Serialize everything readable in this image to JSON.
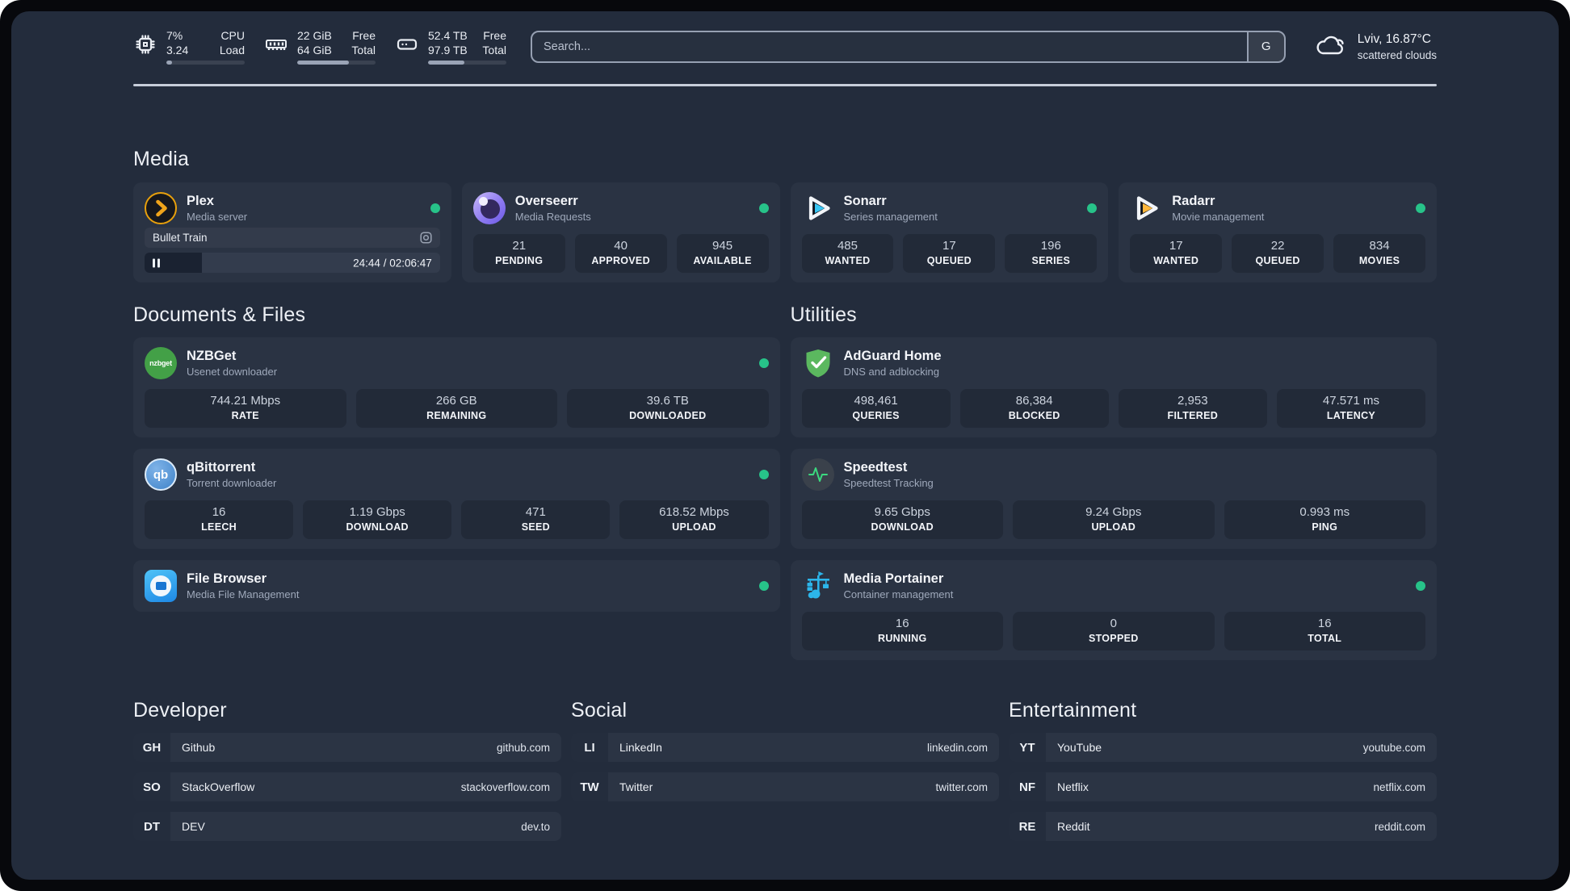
{
  "topbar": {
    "stats": [
      {
        "id": "cpu",
        "value_primary": "7%",
        "value_secondary": "3.24",
        "label_primary": "CPU",
        "label_secondary": "Load",
        "progress_pct": 7
      },
      {
        "id": "memory",
        "value_primary": "22 GiB",
        "value_secondary": "64 GiB",
        "label_primary": "Free",
        "label_secondary": "Total",
        "progress_pct": 66
      },
      {
        "id": "disk",
        "value_primary": "52.4 TB",
        "value_secondary": "97.9 TB",
        "label_primary": "Free",
        "label_secondary": "Total",
        "progress_pct": 46
      }
    ],
    "search": {
      "placeholder": "Search...",
      "engine_button": "G"
    },
    "weather": {
      "location": "Lviv, 16.87°C",
      "condition": "scattered clouds"
    }
  },
  "sections": {
    "media": "Media",
    "documents": "Documents & Files",
    "utilities": "Utilities",
    "developer": "Developer",
    "social": "Social",
    "entertainment": "Entertainment"
  },
  "apps": {
    "plex": {
      "title": "Plex",
      "subtitle": "Media server",
      "status": "online",
      "now_playing": {
        "title": "Bullet Train",
        "time": "24:44 / 02:06:47",
        "progress_pct": 19.5
      }
    },
    "overseerr": {
      "title": "Overseerr",
      "subtitle": "Media Requests",
      "status": "online",
      "stats": [
        {
          "value": "21",
          "label": "PENDING"
        },
        {
          "value": "40",
          "label": "APPROVED"
        },
        {
          "value": "945",
          "label": "AVAILABLE"
        }
      ]
    },
    "sonarr": {
      "title": "Sonarr",
      "subtitle": "Series management",
      "status": "online",
      "stats": [
        {
          "value": "485",
          "label": "WANTED"
        },
        {
          "value": "17",
          "label": "QUEUED"
        },
        {
          "value": "196",
          "label": "SERIES"
        }
      ]
    },
    "radarr": {
      "title": "Radarr",
      "subtitle": "Movie management",
      "status": "online",
      "stats": [
        {
          "value": "17",
          "label": "WANTED"
        },
        {
          "value": "22",
          "label": "QUEUED"
        },
        {
          "value": "834",
          "label": "MOVIES"
        }
      ]
    },
    "nzbget": {
      "title": "NZBGet",
      "subtitle": "Usenet downloader",
      "status": "online",
      "icon_text": "nzbget",
      "stats": [
        {
          "value": "744.21 Mbps",
          "label": "RATE"
        },
        {
          "value": "266 GB",
          "label": "REMAINING"
        },
        {
          "value": "39.6 TB",
          "label": "DOWNLOADED"
        }
      ]
    },
    "qbittorrent": {
      "title": "qBittorrent",
      "subtitle": "Torrent downloader",
      "status": "online",
      "icon_text": "qb",
      "stats": [
        {
          "value": "16",
          "label": "LEECH"
        },
        {
          "value": "1.19 Gbps",
          "label": "DOWNLOAD"
        },
        {
          "value": "471",
          "label": "SEED"
        },
        {
          "value": "618.52 Mbps",
          "label": "UPLOAD"
        }
      ]
    },
    "filebrowser": {
      "title": "File Browser",
      "subtitle": "Media File Management",
      "status": "online"
    },
    "adguard": {
      "title": "AdGuard Home",
      "subtitle": "DNS and adblocking",
      "stats": [
        {
          "value": "498,461",
          "label": "QUERIES"
        },
        {
          "value": "86,384",
          "label": "BLOCKED"
        },
        {
          "value": "2,953",
          "label": "FILTERED"
        },
        {
          "value": "47.571 ms",
          "label": "LATENCY"
        }
      ]
    },
    "speedtest": {
      "title": "Speedtest",
      "subtitle": "Speedtest Tracking",
      "stats": [
        {
          "value": "9.65 Gbps",
          "label": "DOWNLOAD"
        },
        {
          "value": "9.24 Gbps",
          "label": "UPLOAD"
        },
        {
          "value": "0.993 ms",
          "label": "PING"
        }
      ]
    },
    "portainer": {
      "title": "Media Portainer",
      "subtitle": "Container management",
      "status": "online",
      "stats": [
        {
          "value": "16",
          "label": "RUNNING"
        },
        {
          "value": "0",
          "label": "STOPPED"
        },
        {
          "value": "16",
          "label": "TOTAL"
        }
      ]
    }
  },
  "bookmarks": {
    "developer": [
      {
        "abbr": "GH",
        "name": "Github",
        "domain": "github.com"
      },
      {
        "abbr": "SO",
        "name": "StackOverflow",
        "domain": "stackoverflow.com"
      },
      {
        "abbr": "DT",
        "name": "DEV",
        "domain": "dev.to"
      }
    ],
    "social": [
      {
        "abbr": "LI",
        "name": "LinkedIn",
        "domain": "linkedin.com"
      },
      {
        "abbr": "TW",
        "name": "Twitter",
        "domain": "twitter.com"
      }
    ],
    "entertainment": [
      {
        "abbr": "YT",
        "name": "YouTube",
        "domain": "youtube.com"
      },
      {
        "abbr": "NF",
        "name": "Netflix",
        "domain": "netflix.com"
      },
      {
        "abbr": "RE",
        "name": "Reddit",
        "domain": "reddit.com"
      }
    ]
  },
  "colors": {
    "status_online_green": "#27c389",
    "plex_orange": "#e8a00c",
    "sonarr_blue": "#38c6f4",
    "radarr_orange": "#ffb73b",
    "portainer_blue": "#2cb5ea",
    "adguard_green": "#5bb85f"
  }
}
